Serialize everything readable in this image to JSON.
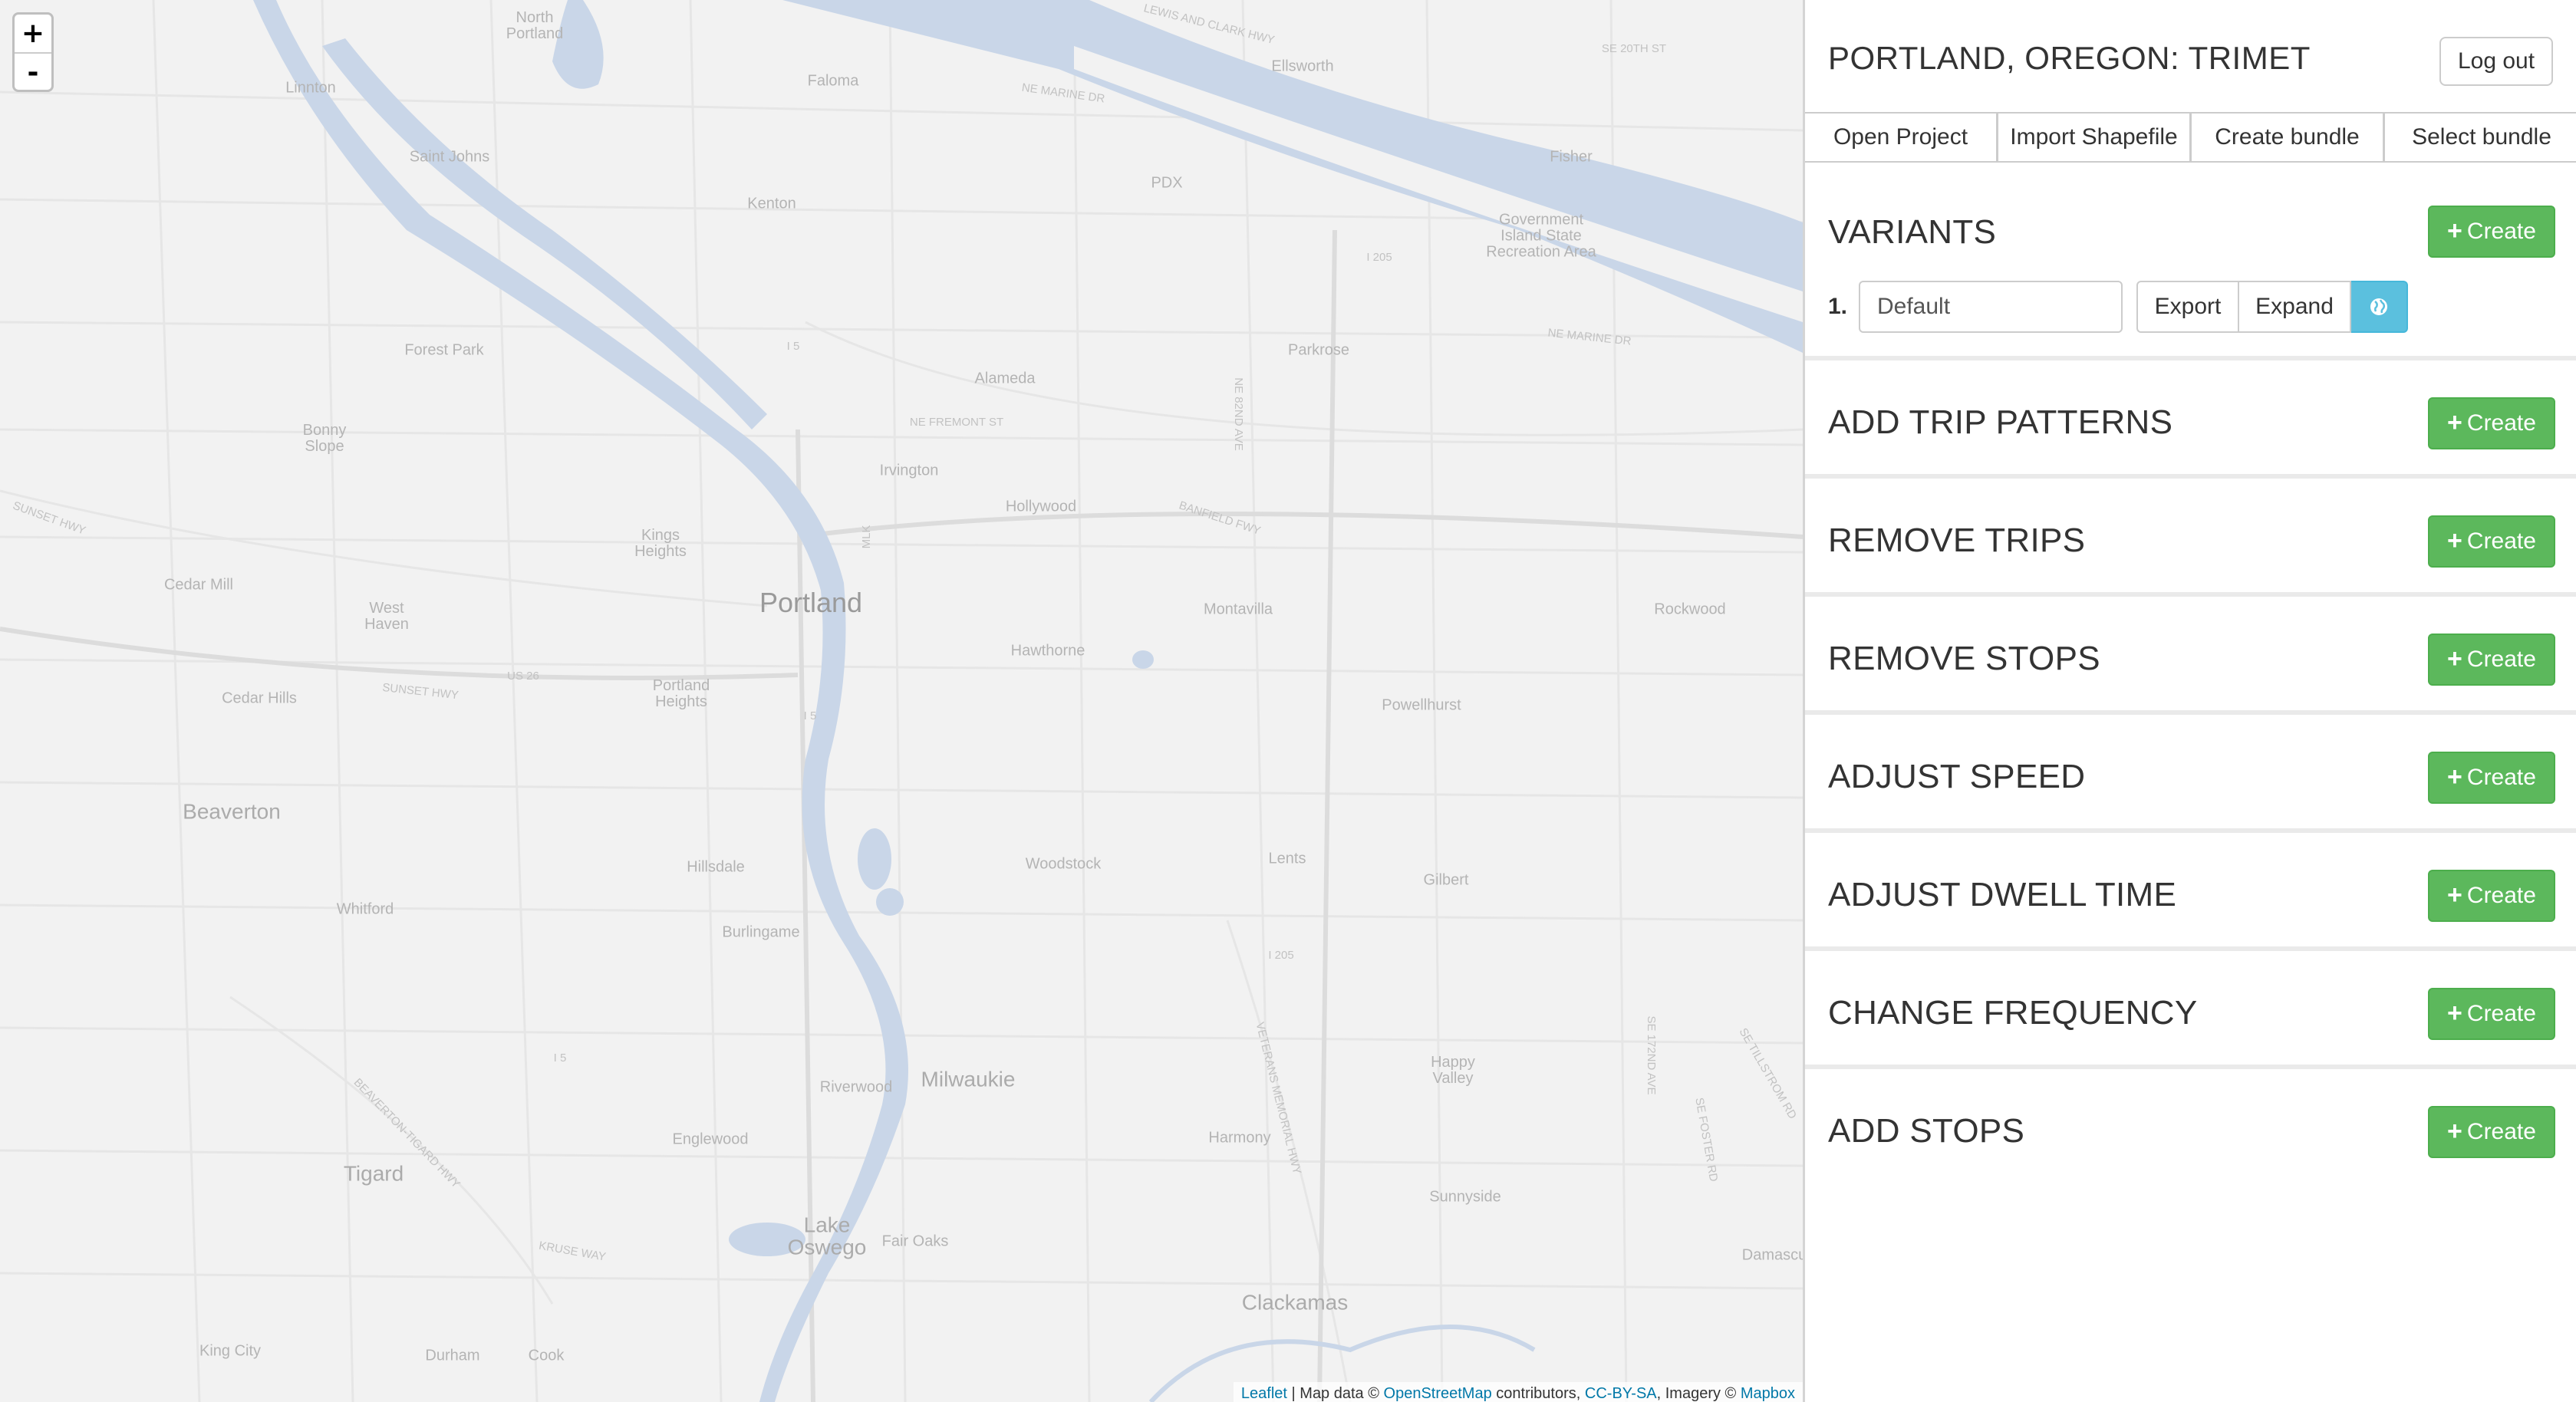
{
  "map": {
    "zoom_in": "+",
    "zoom_out": "-",
    "labels": {
      "portland": "Portland",
      "beaverton": "Beaverton",
      "tigard": "Tigard",
      "milwaukie": "Milwaukie",
      "lake_oswego": "Lake\nOswego",
      "clackamas": "Clackamas",
      "north_portland": "North\nPortland",
      "faloma": "Faloma",
      "linnton": "Linnton",
      "saint_johns": "Saint Johns",
      "kenton": "Kenton",
      "ellsworth": "Ellsworth",
      "pdx": "PDX",
      "fisher": "Fisher",
      "govt_island": "Government\nIsland State\nRecreation Area",
      "forest_park": "Forest Park",
      "alameda": "Alameda",
      "parkrose": "Parkrose",
      "bonny_slope": "Bonny\nSlope",
      "irvington": "Irvington",
      "hollywood": "Hollywood",
      "kings_heights": "Kings\nHeights",
      "cedar_mill": "Cedar Mill",
      "west_haven": "West\nHaven",
      "montavilla": "Montavilla",
      "rockwood": "Rockwood",
      "hawthorne": "Hawthorne",
      "cedar_hills": "Cedar Hills",
      "portland_heights": "Portland\nHeights",
      "powellhurst": "Powellhurst",
      "hillsdale": "Hillsdale",
      "woodstock": "Woodstock",
      "lents": "Lents",
      "gilbert": "Gilbert",
      "whitford": "Whitford",
      "burlingame": "Burlingame",
      "happy_valley": "Happy\nValley",
      "riverwood": "Riverwood",
      "englewood": "Englewood",
      "harmony": "Harmony",
      "sunnyside": "Sunnyside",
      "fair_oaks": "Fair Oaks",
      "damascus": "Damascu",
      "king_city": "King City",
      "durham": "Durham",
      "cook": "Cook",
      "i5_a": "I 5",
      "i5_b": "I 5",
      "i5_c": "I 5",
      "i205_a": "I 205",
      "i205_b": "I 205",
      "us26": "US 26",
      "ne_fremont": "NE FREMONT ST",
      "sunset_hwy_a": "SUNSET HWY",
      "sunset_hwy_b": "SUNSET HWY",
      "ne_marine_a": "NE MARINE DR",
      "ne_marine_b": "NE MARINE DR",
      "lewis_clark": "LEWIS AND CLARK HWY",
      "ne_20th": "SE 20TH ST",
      "banfield": "BANFIELD FWY",
      "ne_82nd": "NE 82ND AVE",
      "beaverton_tigard": "BEAVERTON-TIGARD HWY",
      "veterans": "VETERANS MEMORIAL HWY",
      "kruse": "KRUSE WAY",
      "mlk": "MLK",
      "se_172": "SE 172ND AVE",
      "se_foster": "SE FOSTER RD",
      "se_tillstrom": "SE TILLSTROM RD"
    },
    "attribution": {
      "leaflet": "Leaflet",
      "sep": " | Map data © ",
      "osm": "OpenStreetMap",
      "contrib": " contributors, ",
      "cc": "CC-BY-SA",
      "imagery": ", Imagery © ",
      "mapbox": "Mapbox"
    }
  },
  "sidebar": {
    "region": "PORTLAND, OREGON",
    "separator": ": ",
    "project": "TRIMET",
    "logout_label": "Log out",
    "nav": [
      "Open Project",
      "Import Shapefile",
      "Create bundle",
      "Select bundle"
    ],
    "create_label": "Create",
    "sections": [
      {
        "title": "VARIANTS"
      },
      {
        "title": "ADD TRIP PATTERNS"
      },
      {
        "title": "REMOVE TRIPS"
      },
      {
        "title": "REMOVE STOPS"
      },
      {
        "title": "ADJUST SPEED"
      },
      {
        "title": "ADJUST DWELL TIME"
      },
      {
        "title": "CHANGE FREQUENCY"
      },
      {
        "title": "ADD STOPS"
      }
    ],
    "variant": {
      "number": "1.",
      "name": "Default",
      "export_label": "Export",
      "expand_label": "Expand"
    }
  },
  "colors": {
    "create_green": "#5cb85c",
    "globe_blue": "#5bc0de",
    "water": "#c9d6e8",
    "map_bg": "#f2f2f2"
  },
  "icons": {
    "plus": "plus-icon",
    "globe": "globe-icon"
  }
}
